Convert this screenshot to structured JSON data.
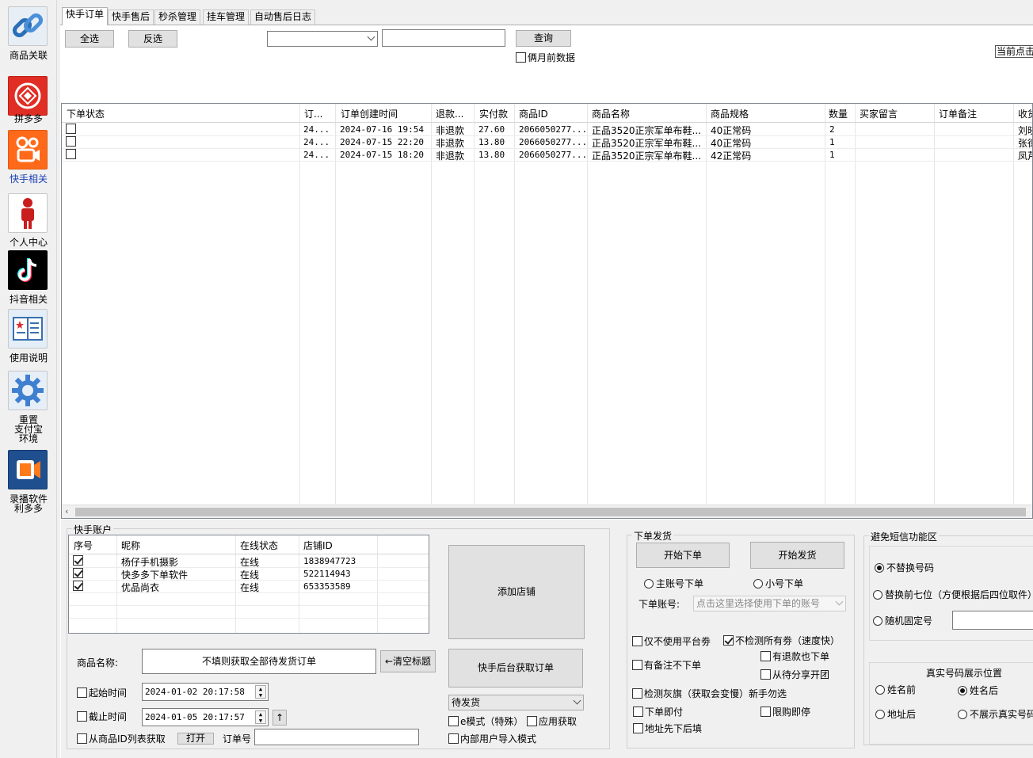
{
  "sidebar": {
    "items": [
      {
        "label": "商品关联",
        "icon": "chain-link-icon"
      },
      {
        "label": "拼多多",
        "icon": "pinduoduo-icon"
      },
      {
        "label": "快手相关",
        "icon": "kuaishou-icon"
      },
      {
        "label": "个人中心",
        "icon": "person-icon"
      },
      {
        "label": "抖音相关",
        "icon": "tiktok-icon"
      },
      {
        "label": "使用说明",
        "icon": "book-icon"
      },
      {
        "label_lines": [
          "重置",
          "支付宝",
          "环境"
        ],
        "icon": "gear-icon"
      },
      {
        "label_lines": [
          "录播软件",
          "利多多"
        ],
        "icon": "video-icon"
      }
    ]
  },
  "tabs": [
    "快手订单",
    "快手售后",
    "秒杀管理",
    "挂车管理",
    "自动售后日志"
  ],
  "toolbar": {
    "select_all": "全选",
    "invert": "反选",
    "query": "查询",
    "two_months": "俩月前数据",
    "current_click": "当前点击"
  },
  "orders": {
    "columns": [
      "下单状态",
      "订...",
      "订单创建时间",
      "退款...",
      "实付款",
      "商品ID",
      "商品名称",
      "商品规格",
      "数量",
      "买家留言",
      "订单备注",
      "收货"
    ],
    "rows": [
      {
        "order": "24...",
        "time": "2024-07-16 19:54",
        "refund": "非退款",
        "paid": "27.60",
        "pid": "2066050277...",
        "name": "正品3520正宗军单布鞋...",
        "spec": "40正常码",
        "qty": "2",
        "buyer": "刘晓"
      },
      {
        "order": "24...",
        "time": "2024-07-15 22:20",
        "refund": "非退款",
        "paid": "13.80",
        "pid": "2066050277...",
        "name": "正品3520正宗军单布鞋...",
        "spec": "40正常码",
        "qty": "1",
        "buyer": "张德"
      },
      {
        "order": "24...",
        "time": "2024-07-15 18:20",
        "refund": "非退款",
        "paid": "13.80",
        "pid": "2066050277...",
        "name": "正品3520正宗军单布鞋...",
        "spec": "42正常码",
        "qty": "1",
        "buyer": "凤芹"
      }
    ]
  },
  "accounts": {
    "title": "快手账户",
    "columns": [
      "序号",
      "昵称",
      "在线状态",
      "店铺ID"
    ],
    "rows": [
      {
        "nick": "杨仔手机摄影",
        "status": "在线",
        "shop": "1838947723"
      },
      {
        "nick": "快多多下单软件",
        "status": "在线",
        "shop": "522114943"
      },
      {
        "nick": "优品尚衣",
        "status": "在线",
        "shop": "653353589"
      }
    ],
    "add_shop": "添加店铺",
    "product_name_label": "商品名称:",
    "product_name_value": "不填则获取全部待发货订单",
    "clear_title": "←清空标题",
    "fetch_orders": "快手后台获取订单",
    "start_time_label": "起始时间",
    "start_time": "2024-01-02 20:17:58",
    "end_time_label": "截止时间",
    "end_time": "2024-01-05 20:17:57",
    "up_arrow": "↑",
    "status_select": "待发货",
    "e_mode": "e模式（特殊）",
    "apply_fetch": "应用获取",
    "from_product_list": "从商品ID列表获取",
    "open": "打开",
    "order_no_label": "订单号",
    "internal_import": "内部用户导入模式"
  },
  "shipping": {
    "title": "下单发货",
    "start_order": "开始下单",
    "start_ship": "开始发货",
    "main_account": "主账号下单",
    "sub_account": "小号下单",
    "account_label": "下单账号:",
    "account_placeholder": "点击这里选择使用下单的账号",
    "only_no_platform_coupon": "仅不使用平台劵",
    "skip_all_coupon_check": "不检测所有劵（速度快）",
    "refund_still_order": "有退款也下单",
    "remark_no_order": "有备注不下单",
    "share_group_open": "从待分享开团",
    "check_gray_flag": "检测灰旗（获取会变慢）新手勿选",
    "order_then_pay": "下单即付",
    "limit_then_stop": "限购即停",
    "address_first": "地址先下后填"
  },
  "sms": {
    "title": "避免短信功能区",
    "no_replace": "不替换号码",
    "replace_first7": "替换前七位（方便根据后四位取件）",
    "random_fixed": "随机固定号",
    "real_title": "真实号码展示位置",
    "before_name": "姓名前",
    "after_name": "姓名后",
    "after_address": "地址后",
    "hide_real": "不展示真实号码"
  }
}
